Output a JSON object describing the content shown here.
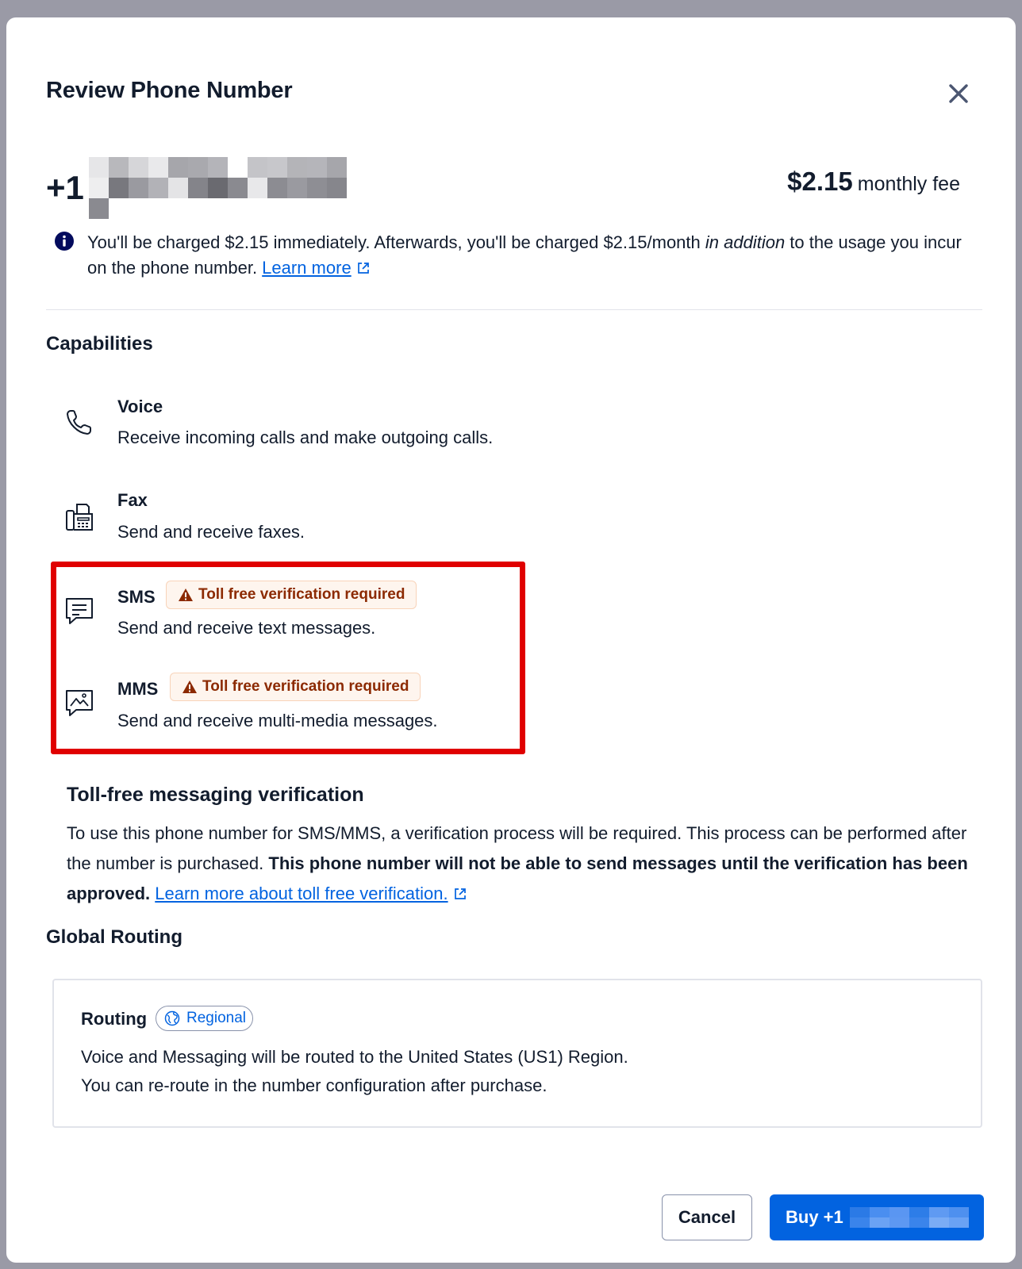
{
  "modal": {
    "title": "Review Phone Number",
    "close_icon": "close-icon"
  },
  "phone": {
    "prefix": "+1",
    "masked_pixels": [
      "#e6e6e8",
      "#b8b8bc",
      "#d6d6d9",
      "#e9e9eb",
      "#a6a6ab",
      "#a9a9ae",
      "#b4b4b9",
      "#ffffff",
      "#c4c4c8",
      "#c7c7cb",
      "#b4b4b8",
      "#b5b5ba",
      "#a6a6ab",
      "#eeeeef",
      "#78787e",
      "#9a9aa0",
      "#b2b2b7",
      "#e4e4e6",
      "#84848a",
      "#6a6a70",
      "#8a8a90",
      "#e8e8ea",
      "#8c8c92",
      "#9a9aa0",
      "#8e8e94",
      "#86868c",
      "#8a8a90"
    ]
  },
  "fee": {
    "amount": "$2.15",
    "label": "monthly fee"
  },
  "charge_notice": {
    "icon": "info-icon",
    "text_before": "You'll be charged $2.15 immediately. Afterwards, you'll be charged $2.15/month ",
    "emphasis": "in addition",
    "text_after": " to the usage you incur on the phone number. ",
    "link": "Learn more"
  },
  "capabilities": {
    "title": "Capabilities",
    "items": [
      {
        "name": "Voice",
        "description": "Receive incoming calls and make outgoing calls.",
        "icon": "phone-icon"
      },
      {
        "name": "Fax",
        "description": "Send and receive faxes.",
        "icon": "fax-icon"
      },
      {
        "name": "SMS",
        "description": "Send and receive text messages.",
        "icon": "chat-icon",
        "badge": "Toll free verification required"
      },
      {
        "name": "MMS",
        "description": "Send and receive multi-media messages.",
        "icon": "image-message-icon",
        "badge": "Toll free verification required"
      }
    ]
  },
  "toll_free": {
    "title": "Toll-free messaging verification",
    "text": "To use this phone number for SMS/MMS, a verification process will be required. This process can be performed after the number is purchased. ",
    "bold_text": "This phone number will not be able to send messages until the verification has been approved.",
    "link": "Learn more about toll free verification."
  },
  "global_routing": {
    "title": "Global Routing",
    "label": "Routing",
    "badge": "Regional",
    "line1": "Voice and Messaging will be routed to the United States (US1) Region.",
    "line2": "You can re-route in the number configuration after purchase."
  },
  "actions": {
    "cancel_label": "Cancel",
    "buy_label": "Buy +1",
    "buy_masked_pixels": [
      "#2b7ae6",
      "#4a8ef0",
      "#5a96f2",
      "#2d7de8",
      "#5f9af2",
      "#4e90ef",
      "#3a84eb",
      "#6aa2f4",
      "#5d98f2",
      "#3a84eb",
      "#7aacf5",
      "#6aa2f4"
    ]
  },
  "colors": {
    "primary": "#0263e0",
    "warning_text": "#8c2a02",
    "warning_bg": "#fef5ee",
    "highlight_border": "#e00000"
  }
}
